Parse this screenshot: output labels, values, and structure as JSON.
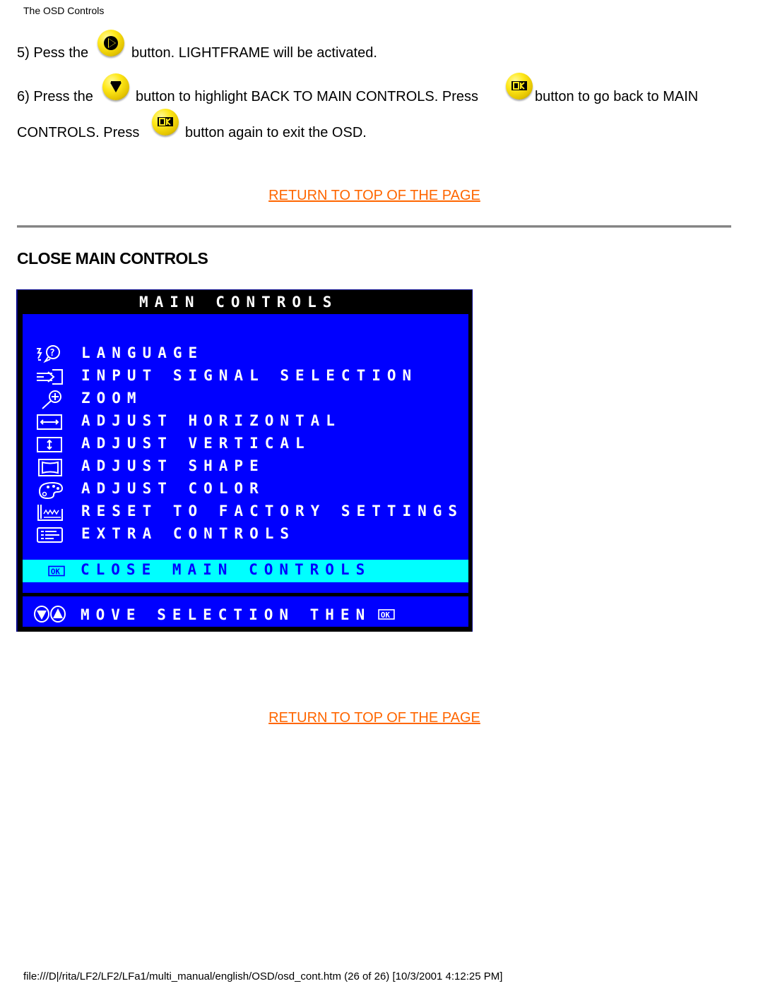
{
  "header": {
    "title": "The OSD Controls"
  },
  "steps": [
    {
      "number_text": "5) Pess the",
      "icon": "right-arrow-button-icon",
      "after_text": "button. LIGHTFRAME will be activated."
    },
    {
      "number_text": "6) Press the",
      "icon": "down-arrow-button-icon",
      "mid_text": "button to highlight BACK TO MAIN CONTROLS. Press",
      "icon2": "ok-button-icon",
      "after_text": "button to go back to MAIN",
      "line2_text": "CONTROLS. Press",
      "icon3": "ok-button-icon",
      "line2_after": "button again to exit the OSD."
    }
  ],
  "links": {
    "return_top": "RETURN TO TOP OF THE PAGE"
  },
  "section": {
    "title": "CLOSE MAIN CONTROLS"
  },
  "osd": {
    "title": "MAIN CONTROLS",
    "items": [
      {
        "label": "LANGUAGE",
        "icon": "language-icon"
      },
      {
        "label": "INPUT SIGNAL SELECTION",
        "icon": "input-signal-icon"
      },
      {
        "label": "ZOOM",
        "icon": "zoom-icon"
      },
      {
        "label": "ADJUST HORIZONTAL",
        "icon": "horizontal-icon"
      },
      {
        "label": "ADJUST VERTICAL",
        "icon": "vertical-icon"
      },
      {
        "label": "ADJUST SHAPE",
        "icon": "shape-icon"
      },
      {
        "label": "ADJUST COLOR",
        "icon": "color-palette-icon"
      },
      {
        "label": "RESET TO FACTORY SETTINGS",
        "icon": "factory-reset-icon"
      },
      {
        "label": "EXTRA CONTROLS",
        "icon": "extra-controls-icon"
      }
    ],
    "selected_item": {
      "label": "CLOSE MAIN CONTROLS",
      "icon": "ok-icon"
    },
    "footer": "MOVE SELECTION THEN",
    "colors": {
      "background": "#0000ff",
      "highlight": "#00ffff",
      "text": "#ffffff",
      "frame": "#000000"
    }
  },
  "footer": {
    "path": "file:///D|/rita/LF2/LF2/LFa1/multi_manual/english/OSD/osd_cont.htm (26 of 26) [10/3/2001 4:12:25 PM]"
  },
  "colors": {
    "link": "#ff6600"
  }
}
